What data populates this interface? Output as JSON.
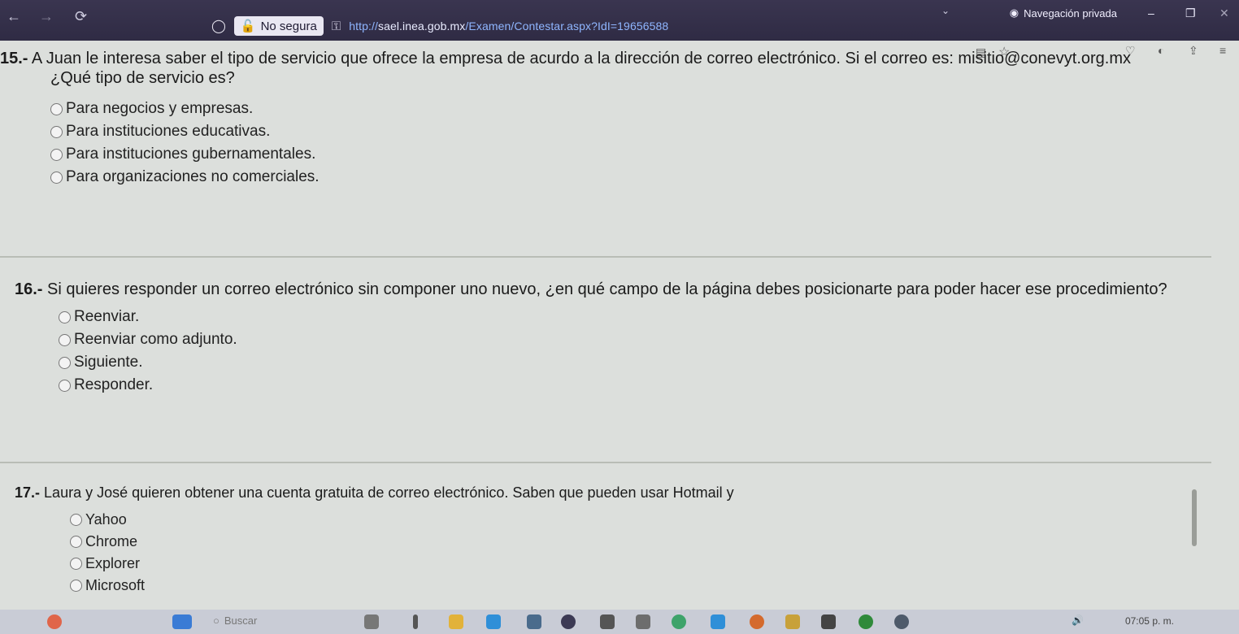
{
  "browser": {
    "insecure_label": "No segura",
    "url_prefix": "http://",
    "url_host": "sael.inea.gob.mx",
    "url_path": "/Examen/Contestar.aspx?IdI=19656588",
    "private_label": "Navegación privada"
  },
  "questions": [
    {
      "number": "15.-",
      "text": "A Juan le interesa saber el tipo de servicio que ofrece la empresa de acurdo a la dirección de correo electrónico. Si el correo es: misitio@conevyt.org.mx",
      "subtext": "¿Qué tipo de servicio es?",
      "options": [
        "Para negocios y empresas.",
        "Para instituciones educativas.",
        "Para instituciones gubernamentales.",
        "Para organizaciones no comerciales."
      ]
    },
    {
      "number": "16.-",
      "text": "Si quieres responder un correo electrónico sin componer uno nuevo, ¿en qué campo de la página debes posicionarte para poder hacer ese procedimiento?",
      "options": [
        "Reenviar.",
        "Reenviar como adjunto.",
        "Siguiente.",
        "Responder."
      ]
    },
    {
      "number": "17.-",
      "text": "Laura y José quieren obtener una cuenta gratuita de correo electrónico. Saben que pueden usar Hotmail y",
      "options": [
        "Yahoo",
        "Chrome",
        "Explorer",
        "Microsoft"
      ]
    }
  ],
  "taskbar": {
    "search_placeholder": "Buscar",
    "clock": "07:05 p. m."
  },
  "colors": {
    "url_link": "#8fb6ff",
    "titlebar": "#2f2b44",
    "page_bg": "#dcdfdc"
  }
}
